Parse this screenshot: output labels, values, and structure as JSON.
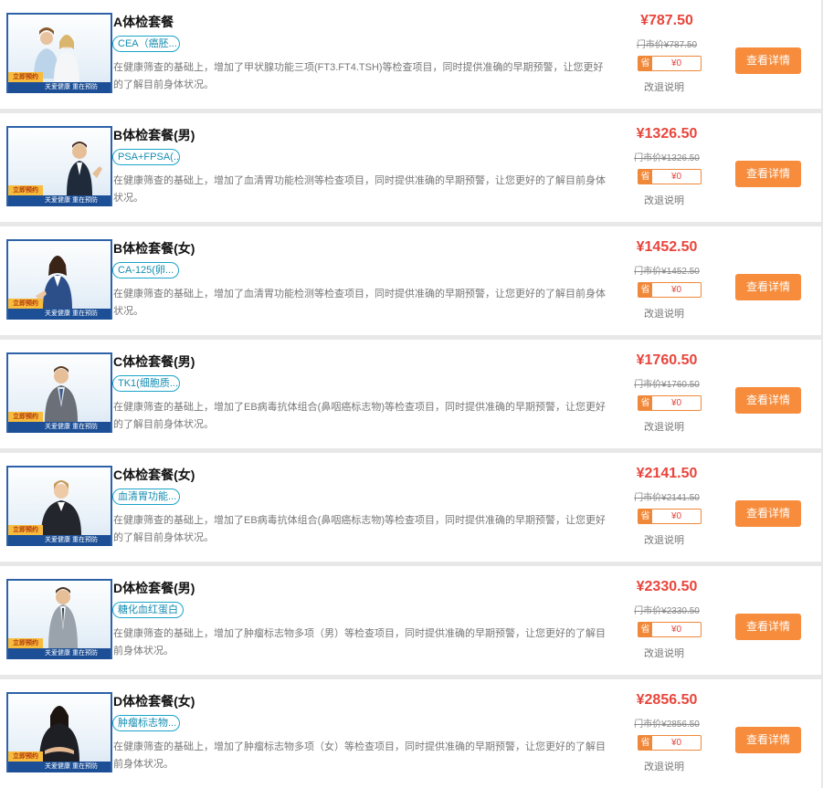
{
  "thumb": {
    "badge": "立即预约",
    "slogan": "关爱健康  重在预防"
  },
  "packages": [
    {
      "title": "A体检套餐",
      "tag": "CEA（癌胚...",
      "desc": "在健康筛查的基础上，增加了甲状腺功能三项(FT3.FT4.TSH)等检查项目，同时提供准确的早期预警，让您更好的了解目前身体状况。",
      "price": "¥787.50",
      "orig": "门市价¥787.50",
      "coupon_icon": "省",
      "coupon": "¥0",
      "refund": "改退说明",
      "button": "查看详情"
    },
    {
      "title": "B体检套餐(男)",
      "tag": "PSA+FPSA(...",
      "desc": "在健康筛查的基础上，增加了血清胃功能检测等检查项目，同时提供准确的早期预警，让您更好的了解目前身体状况。",
      "price": "¥1326.50",
      "orig": "门市价¥1326.50",
      "coupon_icon": "省",
      "coupon": "¥0",
      "refund": "改退说明",
      "button": "查看详情"
    },
    {
      "title": "B体检套餐(女)",
      "tag": "CA-125(卵...",
      "desc": "在健康筛查的基础上，增加了血清胃功能检测等检查项目，同时提供准确的早期预警，让您更好的了解目前身体状况。",
      "price": "¥1452.50",
      "orig": "门市价¥1452.50",
      "coupon_icon": "省",
      "coupon": "¥0",
      "refund": "改退说明",
      "button": "查看详情"
    },
    {
      "title": "C体检套餐(男)",
      "tag": "TK1(细胞质...",
      "desc": "在健康筛查的基础上，增加了EB病毒抗体组合(鼻咽癌标志物)等检查项目，同时提供准确的早期预警，让您更好的了解目前身体状况。",
      "price": "¥1760.50",
      "orig": "门市价¥1760.50",
      "coupon_icon": "省",
      "coupon": "¥0",
      "refund": "改退说明",
      "button": "查看详情"
    },
    {
      "title": "C体检套餐(女)",
      "tag": "血清胃功能...",
      "desc": "在健康筛查的基础上，增加了EB病毒抗体组合(鼻咽癌标志物)等检查项目，同时提供准确的早期预警，让您更好的了解目前身体状况。",
      "price": "¥2141.50",
      "orig": "门市价¥2141.50",
      "coupon_icon": "省",
      "coupon": "¥0",
      "refund": "改退说明",
      "button": "查看详情"
    },
    {
      "title": "D体检套餐(男)",
      "tag": "糖化血红蛋白",
      "desc": "在健康筛查的基础上，增加了肿瘤标志物多项（男）等检查项目，同时提供准确的早期预警，让您更好的了解目前身体状况。",
      "price": "¥2330.50",
      "orig": "门市价¥2330.50",
      "coupon_icon": "省",
      "coupon": "¥0",
      "refund": "改退说明",
      "button": "查看详情"
    },
    {
      "title": "D体检套餐(女)",
      "tag": "肿瘤标志物...",
      "desc": "在健康筛查的基础上，增加了肿瘤标志物多项（女）等检查项目，同时提供准确的早期预警，让您更好的了解目前身体状况。",
      "price": "¥2856.50",
      "orig": "门市价¥2856.50",
      "coupon_icon": "省",
      "coupon": "¥0",
      "refund": "改退说明",
      "button": "查看详情"
    }
  ]
}
